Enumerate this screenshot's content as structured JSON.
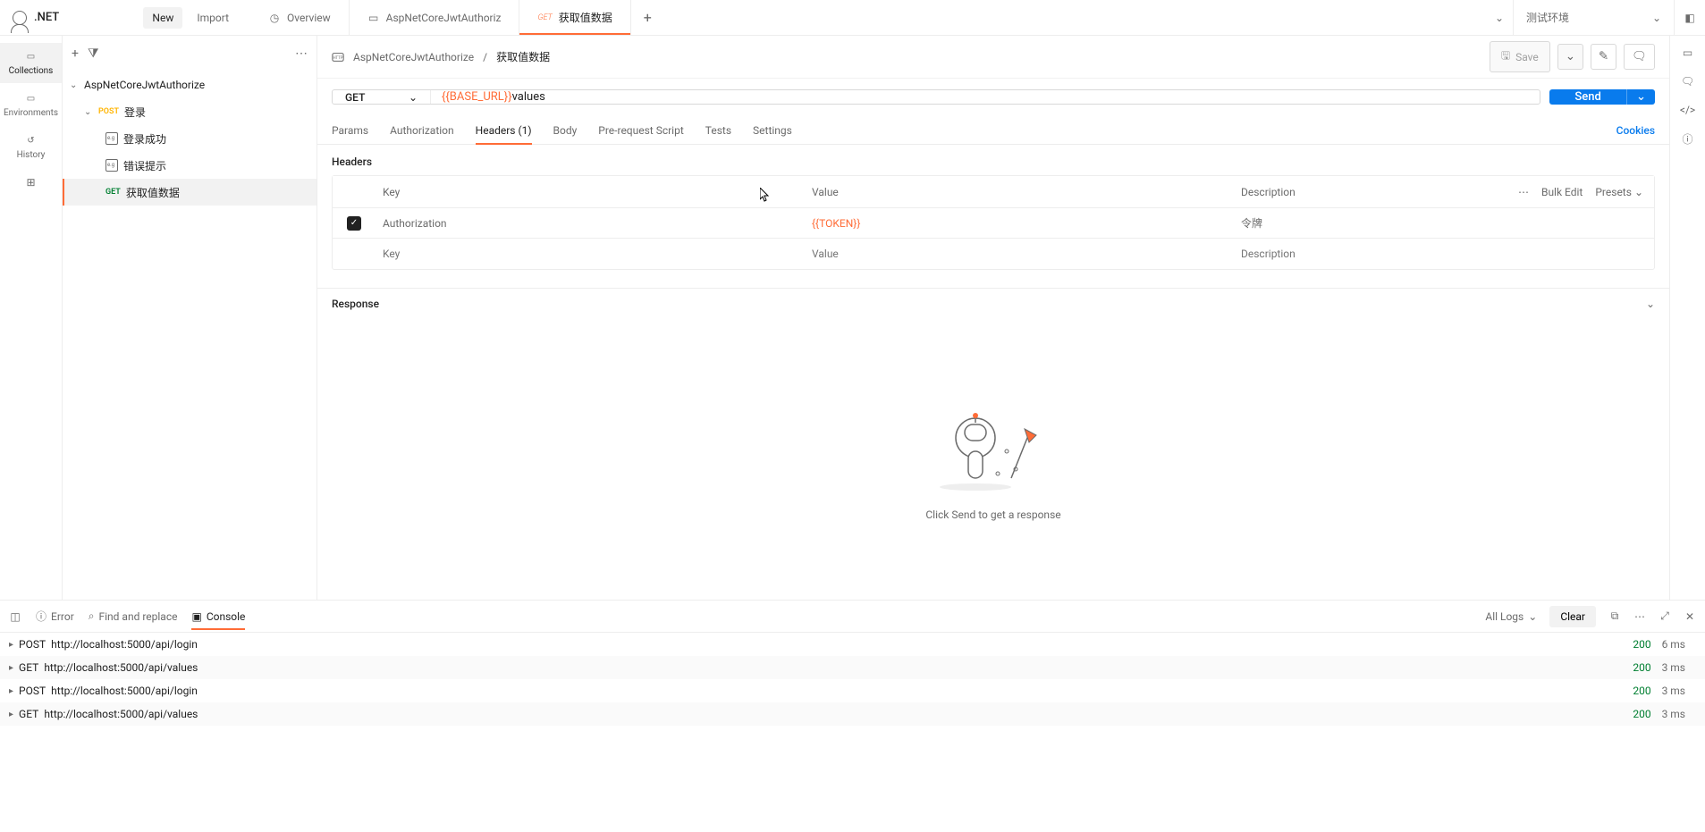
{
  "workspace": {
    "name": ".NET",
    "new": "New",
    "import": "Import"
  },
  "tabs": [
    {
      "icon": "overview",
      "label": "Overview"
    },
    {
      "icon": "collection",
      "label": "AspNetCoreJwtAuthoriz"
    },
    {
      "method": "GET",
      "label": "获取值数据",
      "active": true
    }
  ],
  "environment": {
    "selected": "测试环境"
  },
  "rail": {
    "collections": "Collections",
    "environments": "Environments",
    "history": "History"
  },
  "sidebar": {
    "collection": "AspNetCoreJwtAuthorize",
    "folder": "登录",
    "items": [
      {
        "type": "example",
        "label": "登录成功"
      },
      {
        "type": "example",
        "label": "错误提示"
      },
      {
        "method": "GET",
        "label": "获取值数据",
        "selected": true
      }
    ]
  },
  "breadcrumb": {
    "collection": "AspNetCoreJwtAuthorize",
    "request": "获取值数据",
    "save": "Save"
  },
  "request": {
    "method": "GET",
    "url_var": "{{BASE_URL}}",
    "url_path": "values",
    "send": "Send",
    "tabs": [
      "Params",
      "Authorization",
      "Headers (1)",
      "Body",
      "Pre-request Script",
      "Tests",
      "Settings"
    ],
    "cookies": "Cookies",
    "headers_label": "Headers",
    "columns": {
      "key": "Key",
      "value": "Value",
      "description": "Description"
    },
    "bulk": "Bulk Edit",
    "presets": "Presets",
    "rows": [
      {
        "enabled": true,
        "key": "Authorization",
        "value": "{{TOKEN}}",
        "desc": "令牌"
      }
    ],
    "placeholders": {
      "key": "Key",
      "value": "Value",
      "desc": "Description"
    }
  },
  "response": {
    "label": "Response",
    "empty": "Click Send to get a response"
  },
  "console": {
    "tabs": {
      "error": "Error",
      "find": "Find and replace",
      "console": "Console"
    },
    "filter": "All Logs",
    "clear": "Clear",
    "logs": [
      {
        "method": "POST",
        "url": "http://localhost:5000/api/login",
        "status": "200",
        "time": "6 ms",
        "lang": "</>"
      },
      {
        "method": "GET",
        "url": "http://localhost:5000/api/values",
        "status": "200",
        "time": "3 ms",
        "lang": ""
      },
      {
        "method": "POST",
        "url": "http://localhost:5000/api/login",
        "status": "200",
        "time": "3 ms",
        "lang": "</>"
      },
      {
        "method": "GET",
        "url": "http://localhost:5000/api/values",
        "status": "200",
        "time": "3 ms",
        "lang": ""
      }
    ]
  }
}
